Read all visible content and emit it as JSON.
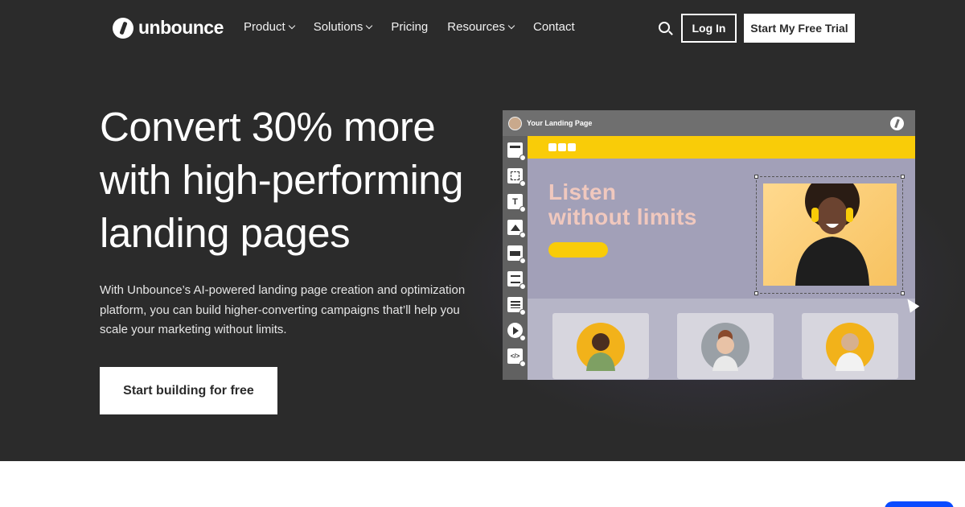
{
  "brand": {
    "name": "unbounce"
  },
  "nav": {
    "items": [
      {
        "label": "Product",
        "has_dropdown": true
      },
      {
        "label": "Solutions",
        "has_dropdown": true
      },
      {
        "label": "Pricing",
        "has_dropdown": false
      },
      {
        "label": "Resources",
        "has_dropdown": true
      },
      {
        "label": "Contact",
        "has_dropdown": false
      }
    ],
    "search_icon": "search-icon",
    "login_label": "Log In",
    "trial_label": "Start My Free Trial"
  },
  "hero": {
    "headline_lines": [
      "Convert 30% more",
      "with high-performing",
      "landing pages"
    ],
    "subtext": "With Unbounce’s AI-powered landing page creation and optimization platform, you can build higher-converting campaigns that’ll help you scale your marketing without limits.",
    "cta_label": "Start building for free"
  },
  "builder": {
    "window_title": "Your Landing Page",
    "headline_lines": [
      "Listen",
      "without limits"
    ],
    "toolbar_icons": [
      "section-icon",
      "box-icon",
      "text-icon",
      "image-icon",
      "button-icon",
      "form-icon",
      "list-icon",
      "video-icon",
      "code-icon"
    ],
    "text_tool_label": "T",
    "code_tool_label": "</>"
  },
  "colors": {
    "hero_bg": "#2b2b2b",
    "accent_yellow": "#f9cc08",
    "builder_purple": "#a2a0b8",
    "headline_pink": "#f0c8be",
    "chat_blue": "#0a4bff"
  }
}
